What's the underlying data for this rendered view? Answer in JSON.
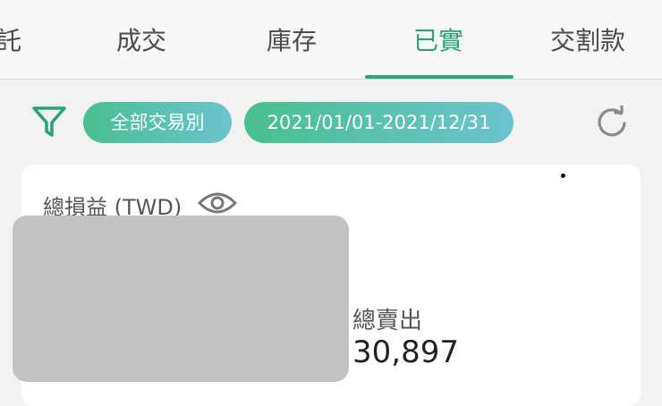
{
  "tabs": [
    {
      "label": "託",
      "active": false
    },
    {
      "label": "成交",
      "active": false
    },
    {
      "label": "庫存",
      "active": false
    },
    {
      "label": "已實",
      "active": true
    },
    {
      "label": "交割款",
      "active": false
    }
  ],
  "filters": {
    "trade_type": "全部交易別",
    "date_range": "2021/01/01-2021/12/31"
  },
  "summary": {
    "title": "總損益 (TWD)",
    "sell_label": "總賣出",
    "sell_value": "30,897"
  },
  "icons": [
    "filter-icon",
    "refresh-icon",
    "eye-icon"
  ],
  "colors": {
    "accent": "#27a27c",
    "chip_gradient_start": "#48bf8e",
    "chip_gradient_end": "#6cc3cf",
    "redaction": "#c2c2c2"
  }
}
